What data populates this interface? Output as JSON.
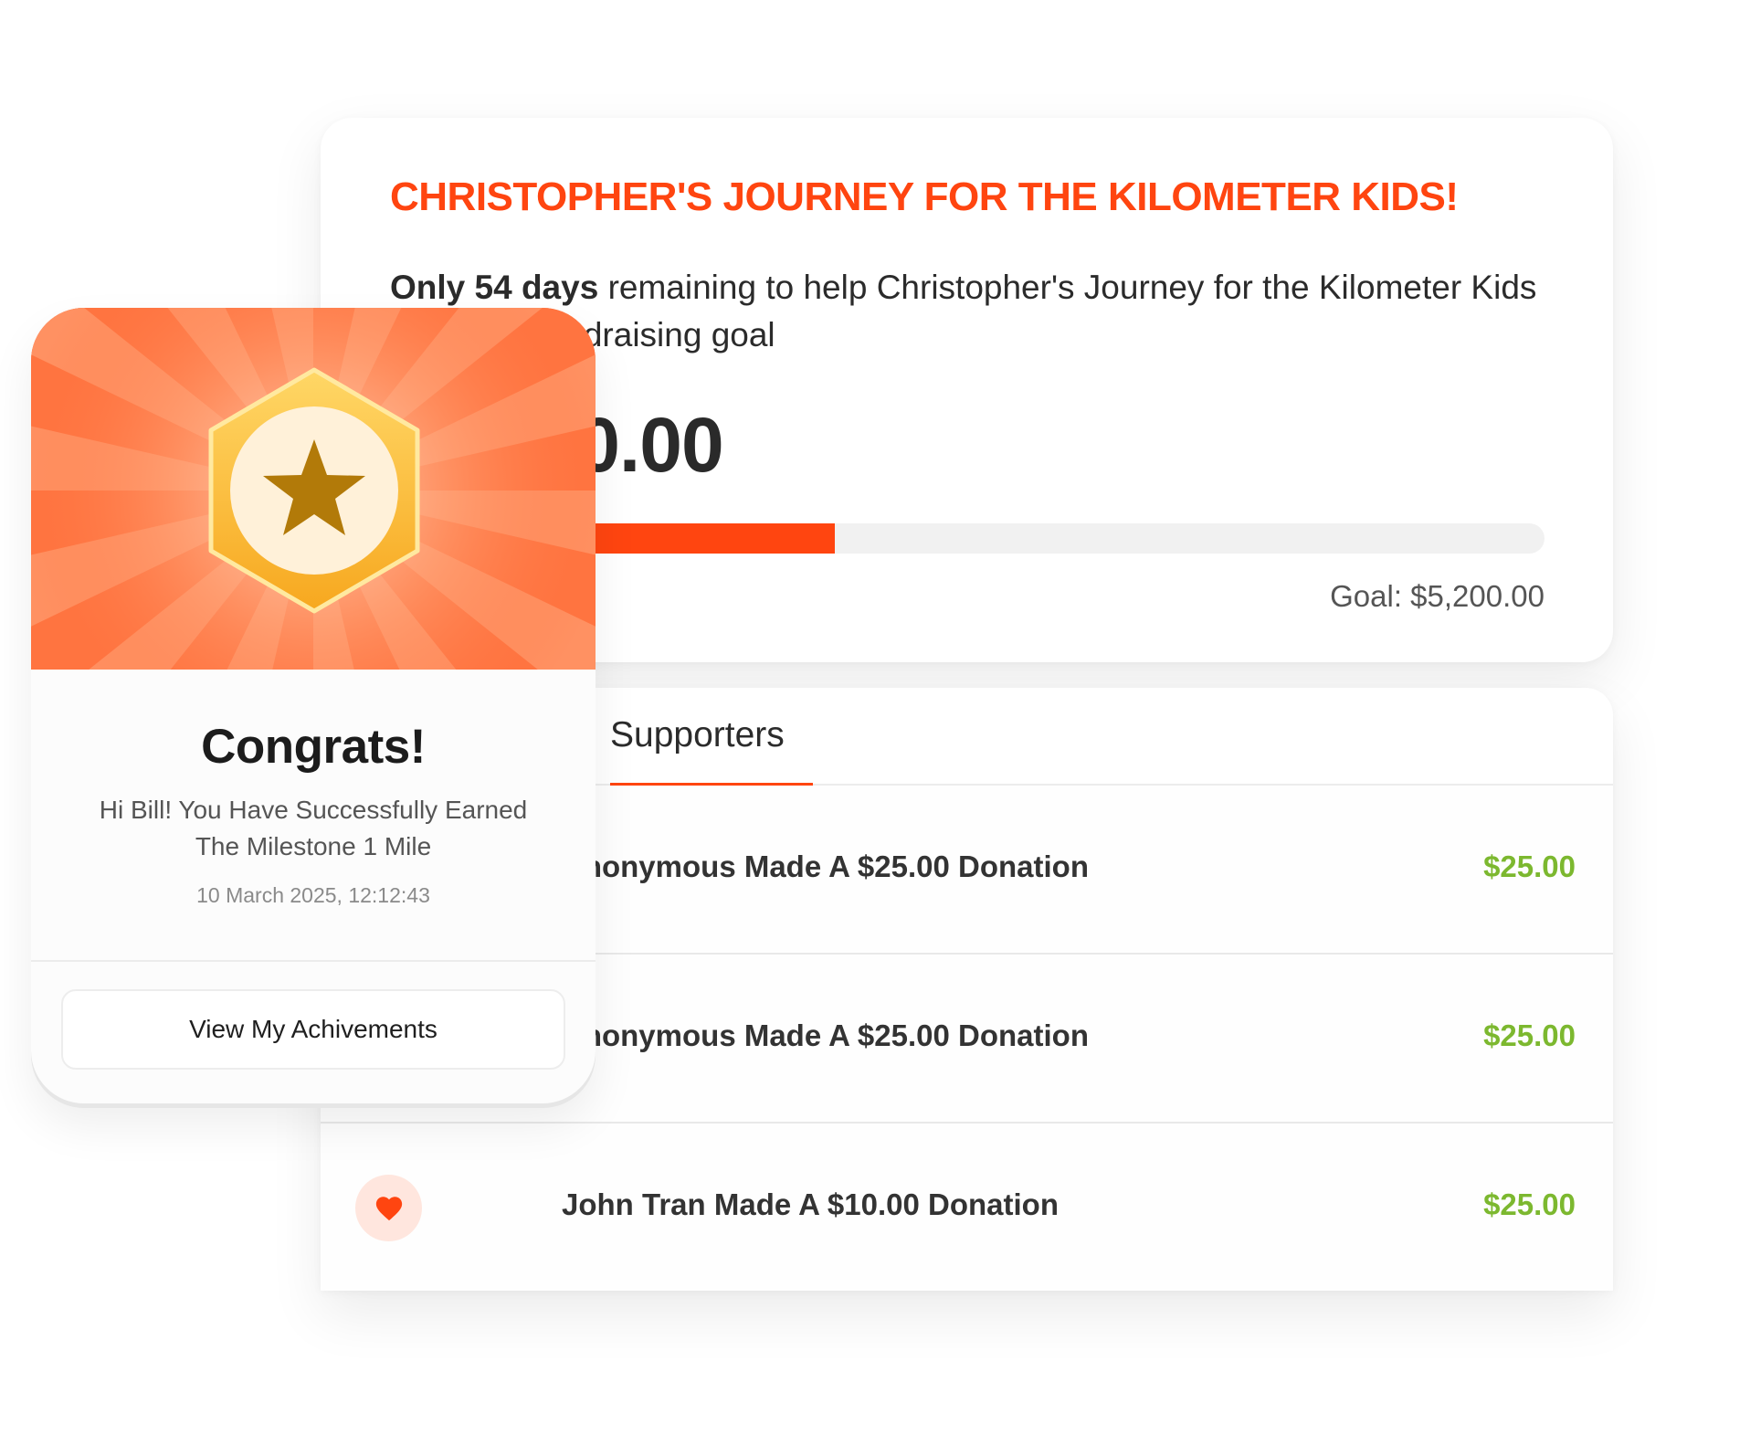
{
  "fundraiser": {
    "title": "CHRISTOPHER'S JOURNEY FOR THE KILOMETER KIDS!",
    "days_bold": "Only 54 days",
    "description": " remaining to help Christopher's Journey for the  Kilometer Kids reach his fundraising goal",
    "raised": "$2,000.00",
    "progress_fraction": 0.385,
    "goal": "Goal: $5,200.00"
  },
  "supporters": {
    "tab_label": "Supporters",
    "rows": [
      {
        "text": "Anonymous Made A $25.00 Donation",
        "amount": "$25.00"
      },
      {
        "text": "Anonymous Made A $25.00 Donation",
        "amount": "$25.00"
      },
      {
        "text": "John Tran Made A $10.00 Donation",
        "amount": "$25.00"
      }
    ]
  },
  "achievement": {
    "title": "Congrats!",
    "message": "Hi Bill! You Have Successfully Earned The Milestone 1 Mile",
    "date": "10 March 2025, 12:12:43",
    "button_label": "View My Achivements",
    "badge_icon": "star-icon"
  },
  "colors": {
    "accent": "#ff4510",
    "amount_green": "#7cb82f",
    "banner_orange": "#ff7a48",
    "badge_gold": "#ffc93c",
    "star_brown": "#b27a09"
  }
}
